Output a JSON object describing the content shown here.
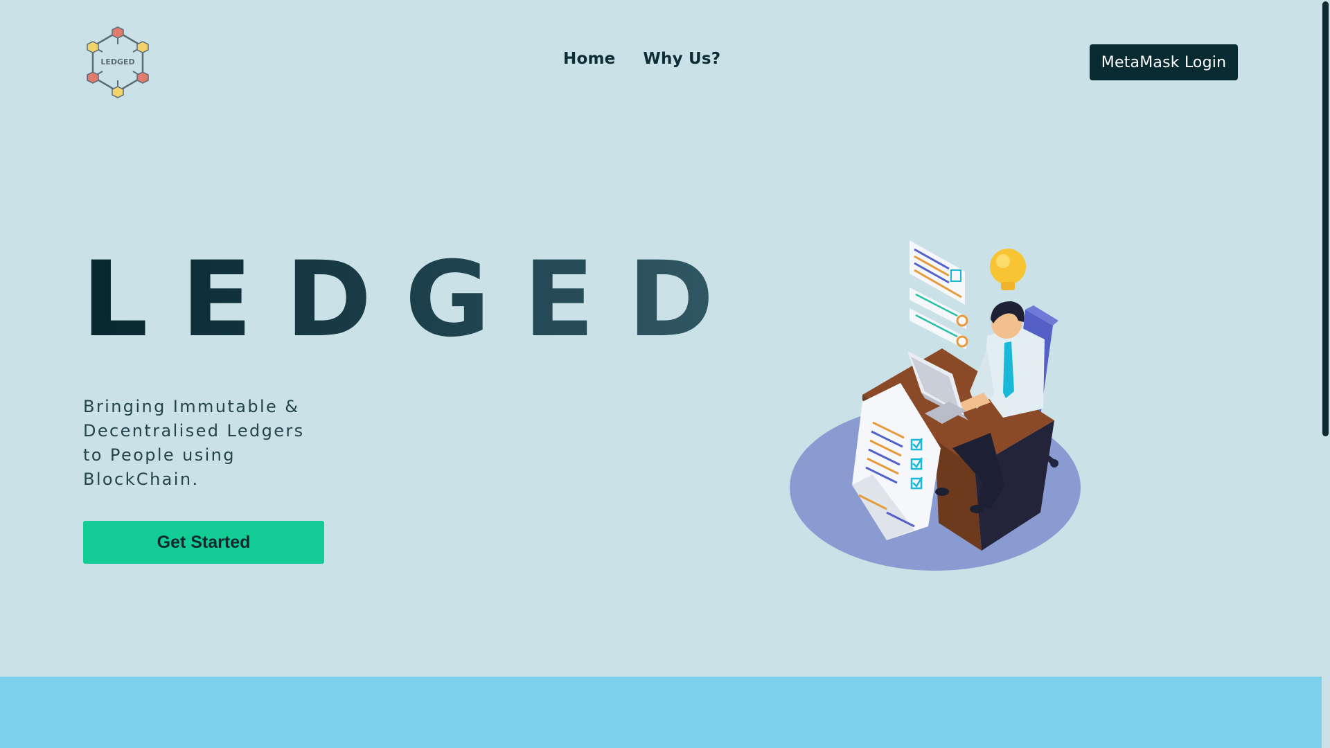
{
  "header": {
    "logo_text": "LEDGED",
    "nav": [
      {
        "label": "Home"
      },
      {
        "label": "Why Us?"
      }
    ],
    "login_label": "MetaMask Login"
  },
  "hero": {
    "title": "LEDGED",
    "subtitle": "Bringing Immutable & Decentralised Ledgers to People using BlockChain.",
    "cta_label": "Get Started"
  },
  "colors": {
    "background": "#c9e1e7",
    "dark": "#082a31",
    "cta": "#14cc96",
    "band": "#7dd0eb"
  },
  "icons": {
    "logo": "hexagon-blockchain-logo-icon",
    "illustration": "person-at-desk-illustration"
  }
}
